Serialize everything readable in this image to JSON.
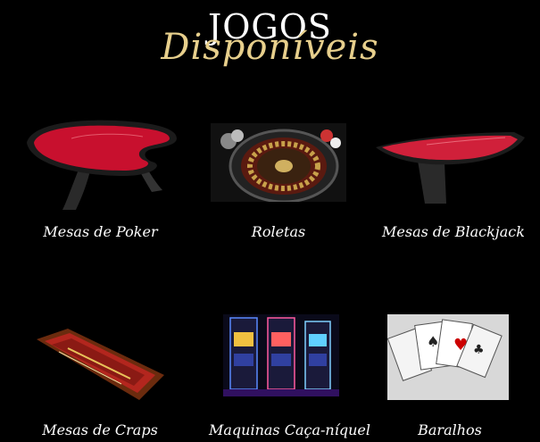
{
  "header": {
    "title_main": "JOGOS",
    "title_script": "Disponíveis"
  },
  "games": [
    {
      "label": "Mesas de Poker",
      "icon": "poker-table-image"
    },
    {
      "label": "Roletas",
      "icon": "roulette-wheel-image"
    },
    {
      "label": "Mesas de Blackjack",
      "icon": "blackjack-table-image"
    },
    {
      "label": "Mesas de Craps",
      "icon": "craps-table-image"
    },
    {
      "label": "Maquinas Caça-níquel",
      "icon": "slot-machines-image"
    },
    {
      "label": "Baralhos",
      "icon": "playing-cards-image"
    }
  ],
  "colors": {
    "background": "#000000",
    "title_gold": "#e7cf8c",
    "felt_red": "#c8102e",
    "text": "#ffffff"
  }
}
